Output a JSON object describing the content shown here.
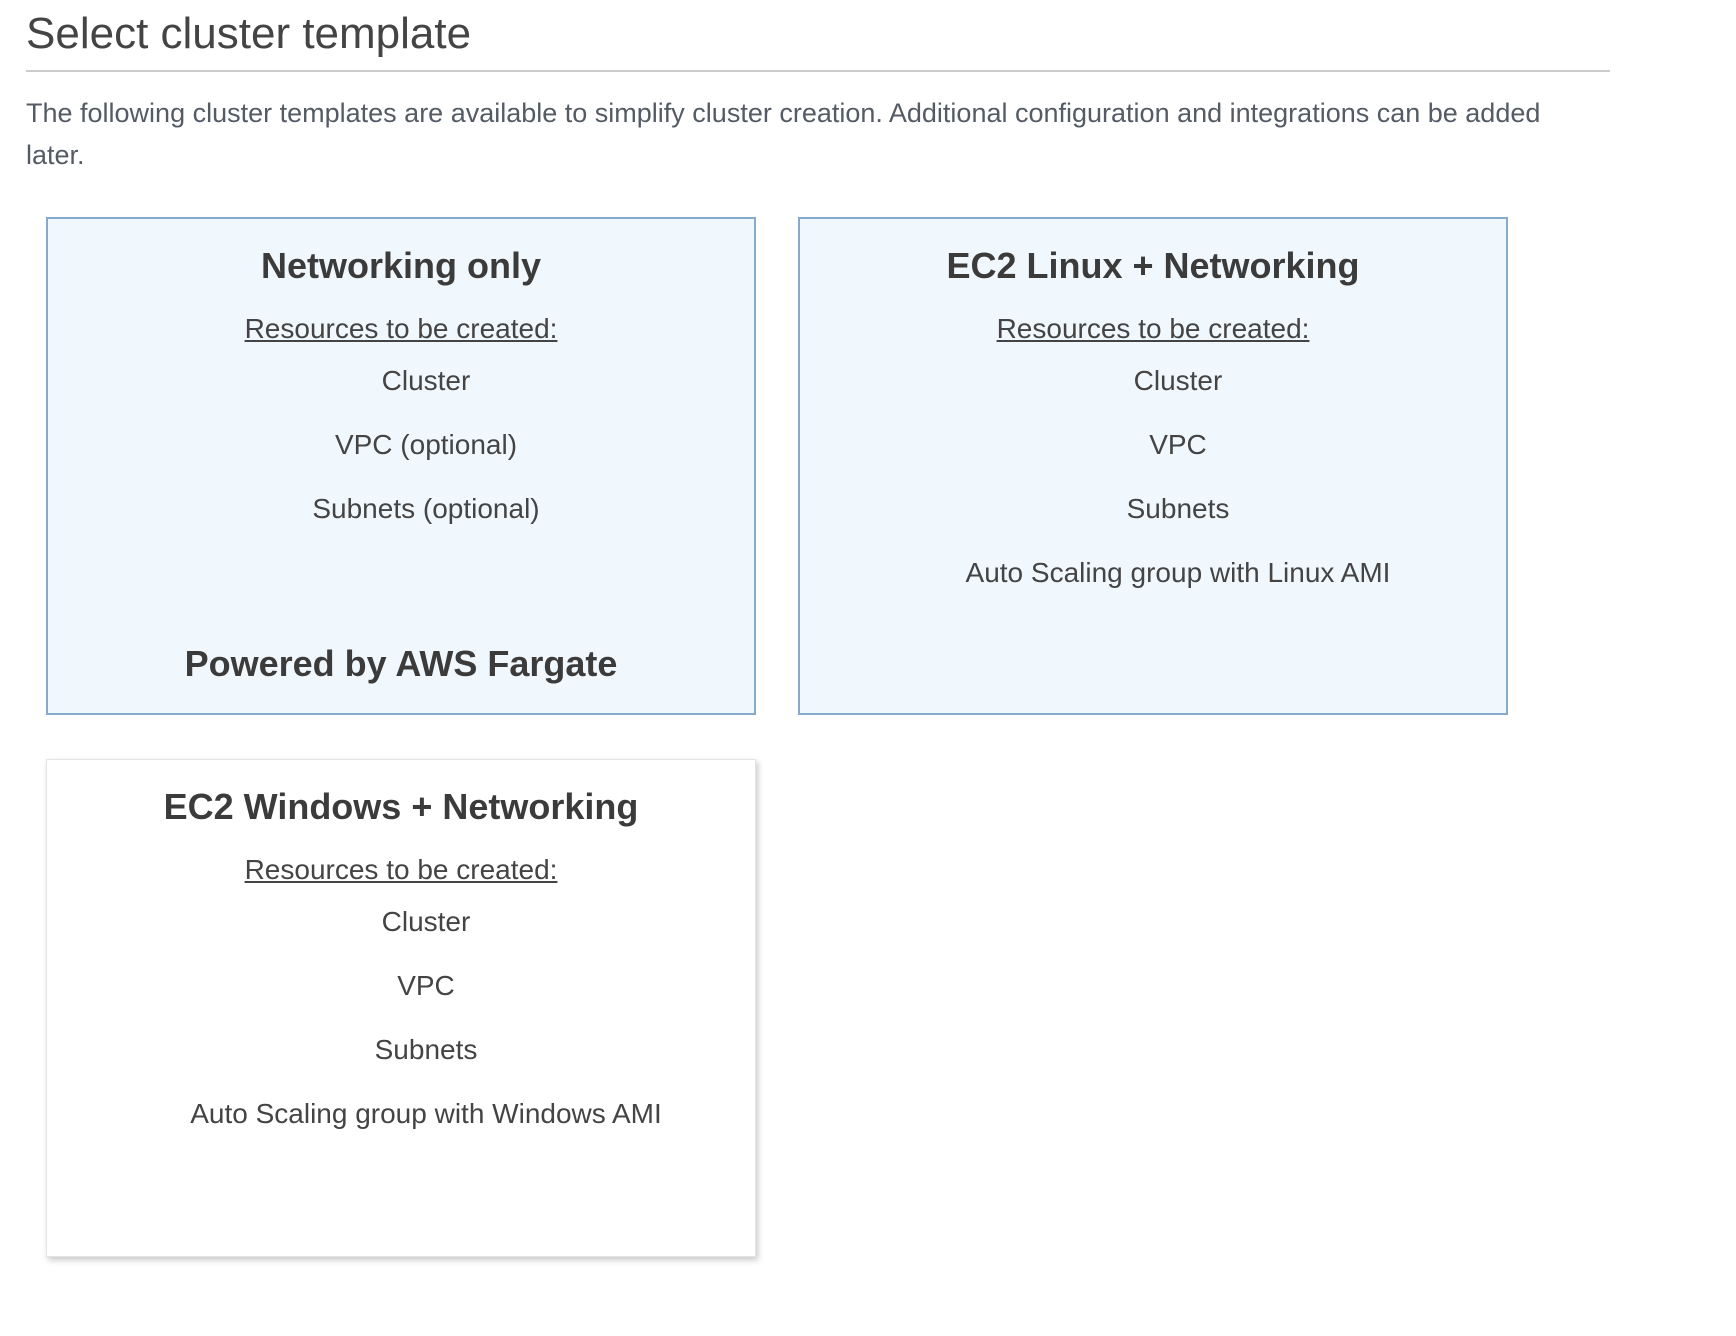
{
  "page": {
    "title": "Select cluster template",
    "description": "The following cluster templates are available to simplify cluster creation. Additional configuration and integrations can be added later."
  },
  "templates": [
    {
      "title": "Networking only",
      "resources_label": "Resources to be created:",
      "resources": [
        "Cluster",
        "VPC (optional)",
        "Subnets (optional)"
      ],
      "footer": "Powered by AWS Fargate",
      "selected": true
    },
    {
      "title": "EC2 Linux + Networking",
      "resources_label": "Resources to be created:",
      "resources": [
        "Cluster",
        "VPC",
        "Subnets",
        "Auto Scaling group with Linux AMI"
      ],
      "footer": "",
      "selected": true
    },
    {
      "title": "EC2 Windows + Networking",
      "resources_label": "Resources to be created:",
      "resources": [
        "Cluster",
        "VPC",
        "Subnets",
        "Auto Scaling group with Windows AMI"
      ],
      "footer": "",
      "selected": false
    }
  ],
  "colors": {
    "card_highlight_bg": "#f0f7fd",
    "card_highlight_border": "#86a9cc",
    "text": "#444444"
  }
}
